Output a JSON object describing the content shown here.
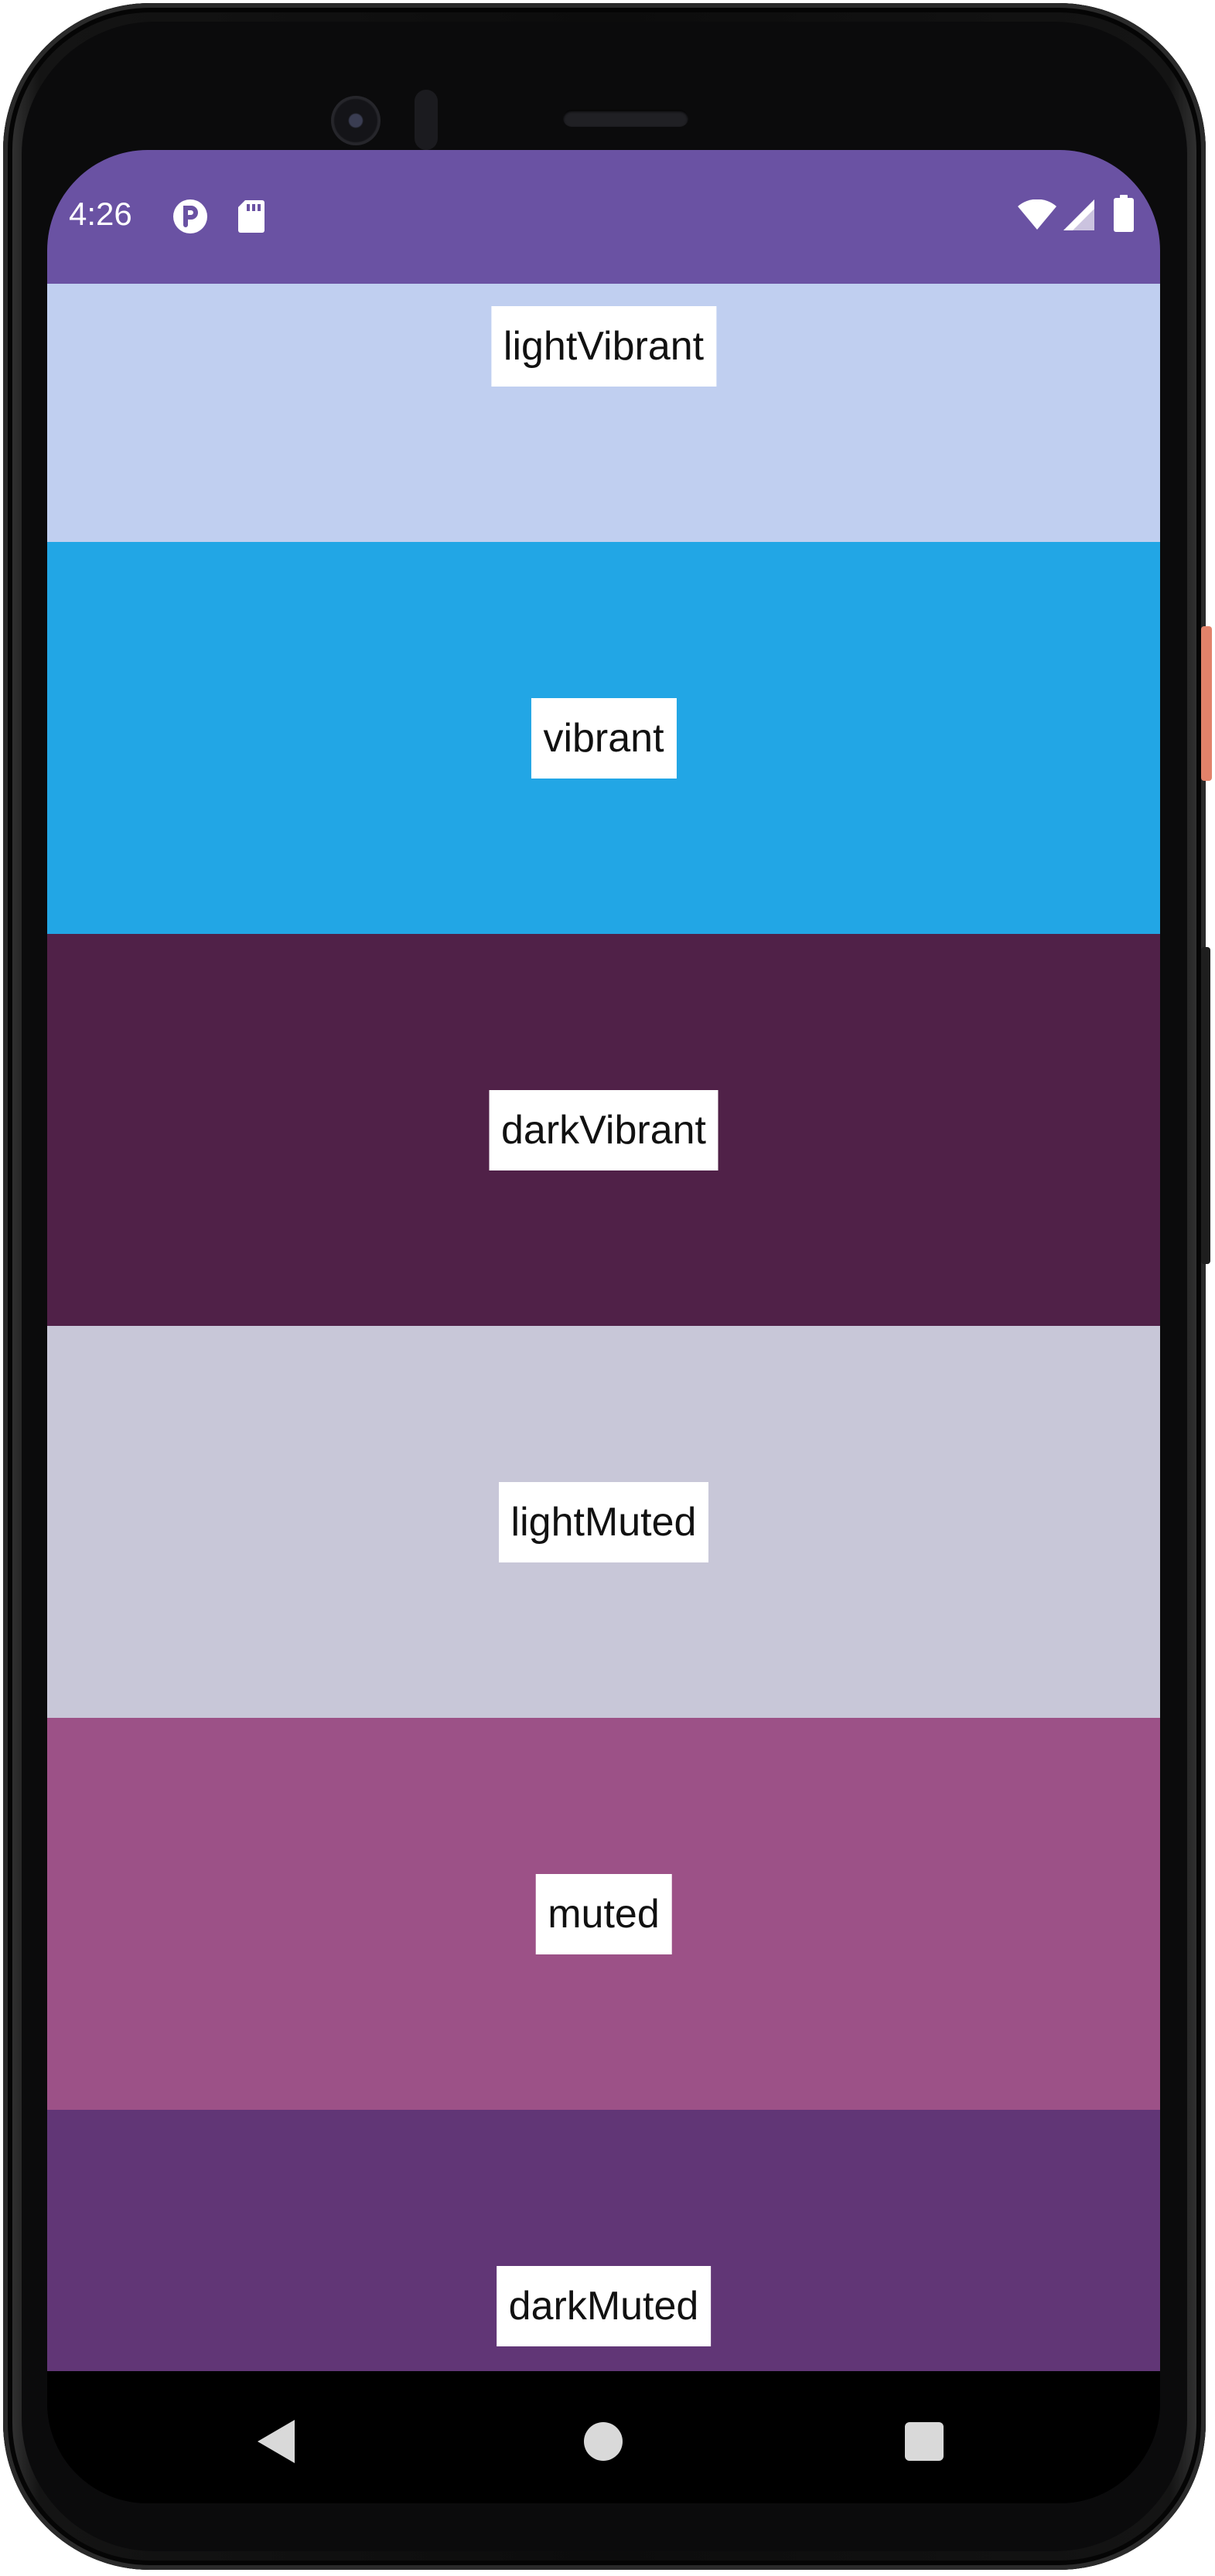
{
  "status_bar": {
    "time": "4:26",
    "background_color": "#6a52a3",
    "left_icons": [
      "data-saver-icon",
      "sd-card-icon"
    ],
    "right_icons": [
      "wifi-icon",
      "cell-signal-icon",
      "battery-icon"
    ]
  },
  "swatches": [
    {
      "label": "lightVibrant",
      "color": "#c0cff0"
    },
    {
      "label": "vibrant",
      "color": "#22a6e5"
    },
    {
      "label": "darkVibrant",
      "color": "#502148"
    },
    {
      "label": "lightMuted",
      "color": "#c8c7d8"
    },
    {
      "label": "muted",
      "color": "#9c5187"
    },
    {
      "label": "darkMuted",
      "color": "#613676"
    }
  ],
  "nav_bar": {
    "buttons": [
      "back-icon",
      "home-icon",
      "recents-icon"
    ]
  }
}
